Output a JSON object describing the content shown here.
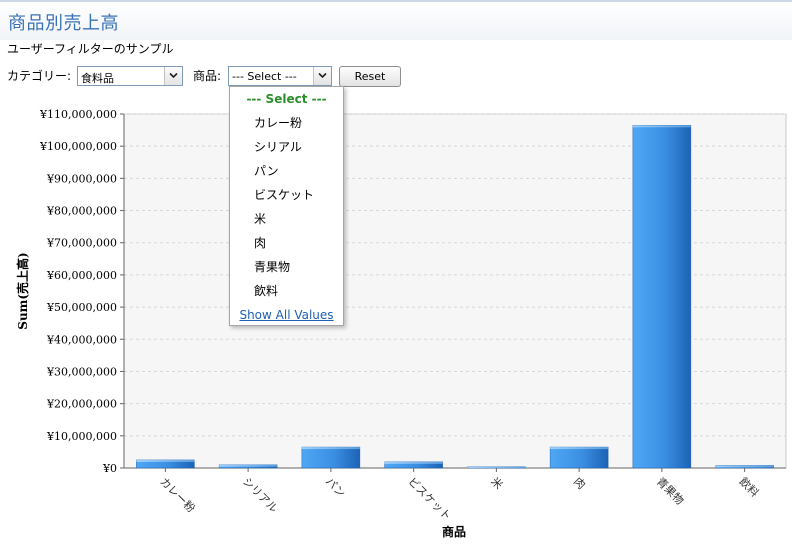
{
  "page": {
    "title": "商品別売上高",
    "subtitle": "ユーザーフィルターのサンプル"
  },
  "filters": {
    "category_label": "カテゴリー:",
    "category_value": "食料品",
    "product_label": "商品:",
    "product_value": "--- Select ---",
    "reset_label": "Reset"
  },
  "dropdown": {
    "header": "--- Select ---",
    "items": [
      "カレー粉",
      "シリアル",
      "パン",
      "ビスケット",
      "米",
      "肉",
      "青果物",
      "飲料"
    ],
    "show_all": "Show All Values"
  },
  "colors": {
    "bar_light": "#4fa7f4",
    "bar_dark": "#1c63b5",
    "title": "#3a72b8",
    "select_header": "#2a8f2a",
    "link": "#1f5fb4"
  },
  "chart_data": {
    "type": "bar",
    "categories": [
      "カレー粉",
      "シリアル",
      "パン",
      "ビスケット",
      "米",
      "肉",
      "青果物",
      "飲料"
    ],
    "values": [
      2500000,
      1000000,
      6500000,
      1900000,
      400000,
      6500000,
      106500000,
      800000
    ],
    "xlabel": "商品",
    "ylabel": "Sum(売上高)",
    "ylim": [
      0,
      110000000
    ],
    "yticks": [
      0,
      10000000,
      20000000,
      30000000,
      40000000,
      50000000,
      60000000,
      70000000,
      80000000,
      90000000,
      100000000,
      110000000
    ],
    "ytick_labels": [
      "¥0",
      "¥10,000,000",
      "¥20,000,000",
      "¥30,000,000",
      "¥40,000,000",
      "¥50,000,000",
      "¥60,000,000",
      "¥70,000,000",
      "¥80,000,000",
      "¥90,000,000",
      "¥100,000,000",
      "¥110,000,000"
    ],
    "grid": true,
    "legend": "none"
  }
}
